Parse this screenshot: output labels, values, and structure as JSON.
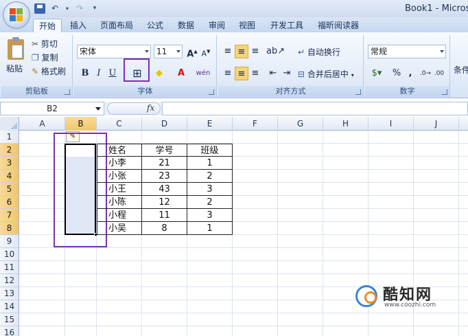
{
  "window": {
    "title": "Book1 - Microso"
  },
  "tabs": [
    {
      "label": "开始",
      "active": true
    },
    {
      "label": "插入"
    },
    {
      "label": "页面布局"
    },
    {
      "label": "公式"
    },
    {
      "label": "数据"
    },
    {
      "label": "审阅"
    },
    {
      "label": "视图"
    },
    {
      "label": "开发工具"
    },
    {
      "label": "福昕阅读器"
    }
  ],
  "ribbon": {
    "clipboard": {
      "label": "剪贴板",
      "paste": "粘贴",
      "cut": "剪切",
      "copy": "复制",
      "format_painter": "格式刷"
    },
    "font": {
      "label": "字体",
      "name": "宋体",
      "size": "11",
      "bold": "B",
      "italic": "I",
      "underline": "U",
      "wen": "wén"
    },
    "alignment": {
      "label": "对齐方式",
      "wrap_text": "自动换行",
      "merge_center": "合并后居中"
    },
    "number": {
      "label": "数字",
      "format": "常规",
      "percent": "%",
      "comma": ","
    },
    "styles": {
      "label_partial": "条件"
    }
  },
  "formula_bar": {
    "name_box": "B2",
    "fx": "fx",
    "value": ""
  },
  "columns": [
    "A",
    "B",
    "C",
    "D",
    "E",
    "F",
    "G",
    "H",
    "I",
    "J"
  ],
  "selected_column": "B",
  "rows": [
    "1",
    "2",
    "3",
    "4",
    "5",
    "6",
    "7",
    "8",
    "9",
    "10",
    "11",
    "12",
    "13",
    "14",
    "15",
    "16"
  ],
  "selected_rows": [
    "2",
    "3",
    "4",
    "5",
    "6",
    "7",
    "8"
  ],
  "table": {
    "headers": [
      "姓名",
      "学号",
      "班级"
    ],
    "rows": [
      [
        "小李",
        "21",
        "1"
      ],
      [
        "小张",
        "23",
        "2"
      ],
      [
        "小王",
        "43",
        "3"
      ],
      [
        "小陈",
        "12",
        "2"
      ],
      [
        "小程",
        "11",
        "3"
      ],
      [
        "小吴",
        "8",
        "1"
      ]
    ]
  },
  "watermark": {
    "title": "酷知网",
    "url": "www.coozhi.com"
  },
  "colors": {
    "highlight_box": "#7a2fb6",
    "selected_header": "#f4c870",
    "ribbon_bg": "#dfe9f6"
  }
}
